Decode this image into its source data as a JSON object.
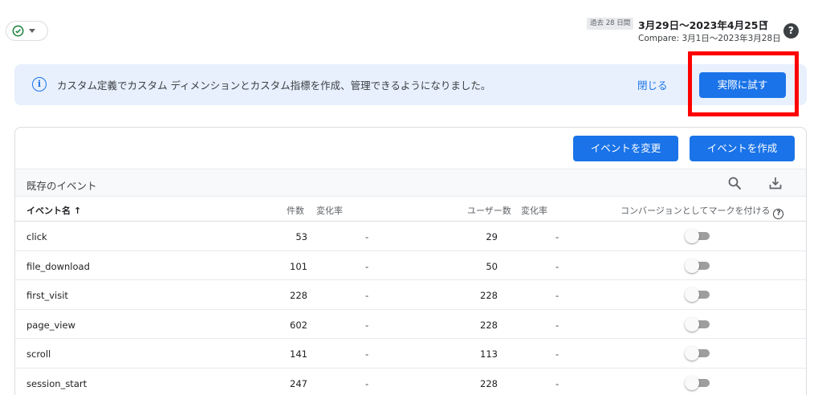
{
  "status": {
    "icon": "check-circle-icon",
    "caret_icon": "caret-down-icon"
  },
  "date_range": {
    "badge": "過去 28 日間",
    "range": "3月29日～2023年4月25日",
    "compare": "Compare: 3月1日～2023年3月28日"
  },
  "help_icon": "?",
  "banner": {
    "icon": "info-icon",
    "message": "カスタム定義でカスタム ディメンションとカスタム指標を作成、管理できるようになりました。",
    "close_label": "閉じる",
    "try_label": "実際に試す"
  },
  "toolbar": {
    "modify_label": "イベントを変更",
    "create_label": "イベントを作成"
  },
  "section": {
    "title": "既存のイベント",
    "search_icon": "search-icon",
    "download_icon": "download-icon"
  },
  "table": {
    "headers": {
      "name": "イベント名",
      "sort": "↑",
      "count": "件数",
      "count_change": "変化率",
      "users": "ユーザー数",
      "users_change": "変化率",
      "conversion": "コンバージョンとしてマークを付ける",
      "conversion_help": "?"
    },
    "rows": [
      {
        "name": "click",
        "count": "53",
        "count_change": "-",
        "users": "29",
        "users_change": "-",
        "conversion": false
      },
      {
        "name": "file_download",
        "count": "101",
        "count_change": "-",
        "users": "50",
        "users_change": "-",
        "conversion": false
      },
      {
        "name": "first_visit",
        "count": "228",
        "count_change": "-",
        "users": "228",
        "users_change": "-",
        "conversion": false
      },
      {
        "name": "page_view",
        "count": "602",
        "count_change": "-",
        "users": "228",
        "users_change": "-",
        "conversion": false
      },
      {
        "name": "scroll",
        "count": "141",
        "count_change": "-",
        "users": "113",
        "users_change": "-",
        "conversion": false
      },
      {
        "name": "session_start",
        "count": "247",
        "count_change": "-",
        "users": "228",
        "users_change": "-",
        "conversion": false
      }
    ]
  },
  "colors": {
    "accent": "#1a73e8",
    "banner_bg": "#e8f0fe",
    "highlight": "#ff0000",
    "status_ok": "#188038"
  }
}
